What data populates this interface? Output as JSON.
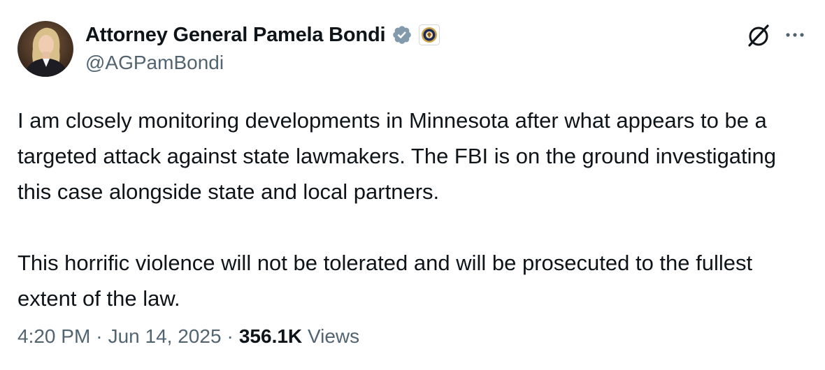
{
  "author": {
    "display_name": "Attorney General Pamela Bondi",
    "handle": "@AGPamBondi",
    "verified_badge_icon": "gray-checkmark-badge-icon",
    "affiliation_icon": "doj-seal-icon"
  },
  "header_actions": {
    "grok_icon": "grok-icon",
    "more_icon": "more-options-icon"
  },
  "tweet": {
    "paragraphs": [
      "I am closely monitoring developments in Minnesota after what appears to be a targeted attack against state lawmakers. The FBI is on the ground investigating this case alongside state and local partners.",
      "This horrific violence will not be tolerated and will be prosecuted to the fullest extent of the law."
    ]
  },
  "meta": {
    "time": "4:20 PM",
    "separator": "·",
    "date": "Jun 14, 2025",
    "views_count": "356.1K",
    "views_label": "Views"
  },
  "colors": {
    "text_primary": "#0f1419",
    "text_secondary": "#536471",
    "badge_gray": "#829aab",
    "background": "#ffffff"
  }
}
